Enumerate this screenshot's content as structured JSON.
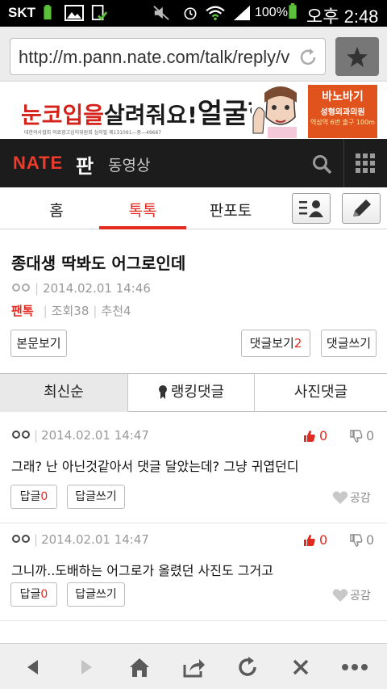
{
  "statusbar": {
    "carrier": "SKT",
    "battery_pct": "100%",
    "clock": "오후 2:48"
  },
  "browser": {
    "url": "http://m.pann.nate.com/talk/reply/v"
  },
  "ad": {
    "text_red": "눈코입을",
    "text_black": "살려줘요!",
    "text_big": "얼굴형",
    "fineprint": "대한의사협회 의료광고심의위원회 심의필 제131091—중—49667",
    "brand_top": "",
    "brand_name": "바노바기",
    "brand_sub": "성형외과의원",
    "brand_loc": "역삼역 6번 출구 100m"
  },
  "header": {
    "logo": "NATE",
    "pan": "판",
    "video": "동영상"
  },
  "tabs": [
    {
      "label": "홈"
    },
    {
      "label": "톡톡"
    },
    {
      "label": "판포토"
    }
  ],
  "post": {
    "title": "종대생 딱봐도 어그로인데",
    "date": "2014.02.01 14:46",
    "category": "팬톡",
    "views": "조회38",
    "recommends": "추천4",
    "view_body_btn": "본문보기",
    "view_comments_label": "댓글보기",
    "comment_count": "2",
    "write_comment_btn": "댓글쓰기"
  },
  "sort": [
    {
      "label": "최신순"
    },
    {
      "label": "랭킹댓글"
    },
    {
      "label": "사진댓글"
    }
  ],
  "comments": [
    {
      "date": "2014.02.01 14:47",
      "up": "0",
      "down": "0",
      "text": "그래? 난 아닌것같아서 댓글 달았는데? 그냥 귀엽던디",
      "reply_label": "답글",
      "reply_count": "0",
      "write_reply": "답글쓰기",
      "like": "공감"
    },
    {
      "date": "2014.02.01 14:47",
      "up": "0",
      "down": "0",
      "text": "그니까..도배하는 어그로가 올렸던 사진도 그거고",
      "reply_label": "답글",
      "reply_count": "0",
      "write_reply": "답글쓰기",
      "like": "공감"
    }
  ],
  "colors": {
    "accent_red": "#e12b21",
    "header_dark": "#1c1c1c"
  }
}
